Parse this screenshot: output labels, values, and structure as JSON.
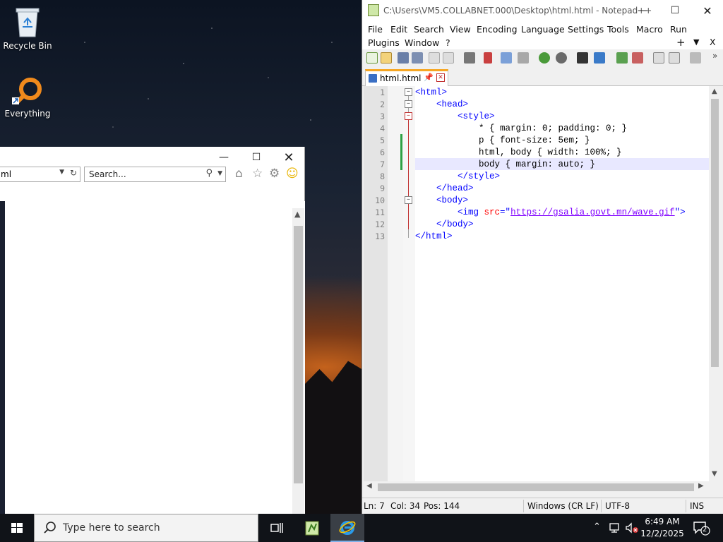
{
  "desktop": {
    "icons": [
      {
        "label": "Recycle Bin"
      },
      {
        "label": "Everything"
      }
    ]
  },
  "browser": {
    "address_value": "ml",
    "search_placeholder": "Search..."
  },
  "notepad": {
    "title": "C:\\Users\\VM5.COLLABNET.000\\Desktop\\html.html - Notepad++",
    "menu": [
      "File",
      "Edit",
      "Search",
      "View",
      "Encoding",
      "Language",
      "Settings",
      "Tools",
      "Macro",
      "Run",
      "Plugins",
      "Window",
      "?"
    ],
    "menu_right": {
      "plus": "+",
      "dropdown": "▼",
      "close": "X"
    },
    "tab_label": "html.html",
    "lines": [
      {
        "n": "1",
        "text": "<html>"
      },
      {
        "n": "2",
        "text": "    <head>"
      },
      {
        "n": "3",
        "text": "        <style>"
      },
      {
        "n": "4",
        "text": "            * { margin: 0; padding: 0; }"
      },
      {
        "n": "5",
        "text": "            p { font-size: 5em; }"
      },
      {
        "n": "6",
        "text": "            html, body { width: 100%; }"
      },
      {
        "n": "7",
        "text": "            body { margin: auto; }"
      },
      {
        "n": "8",
        "text": "        </style>"
      },
      {
        "n": "9",
        "text": "    </head>"
      },
      {
        "n": "10",
        "text": "    <body>"
      },
      {
        "n": "11",
        "text": "        <img src=\"https://gsalia.govt.mn/wave.gif\">"
      },
      {
        "n": "12",
        "text": "    </body>"
      },
      {
        "n": "13",
        "text": "</html>"
      }
    ],
    "line11": {
      "indent": "        ",
      "open": "<img ",
      "attr": "src",
      "eq": "=\"",
      "url": "https://gsalia.govt.mn/wave.gif",
      "close": "\">"
    },
    "status": {
      "ln": "Ln: 7",
      "col": "Col: 34",
      "pos": "Pos: 144",
      "eol": "Windows (CR LF)",
      "encoding": "UTF-8",
      "mode": "INS"
    }
  },
  "taskbar": {
    "search_placeholder": "Type here to search",
    "time": "6:49 AM",
    "date": "12/2/2025",
    "notification_count": "2"
  },
  "colors": {
    "tag": "#0000ff",
    "attr": "#ff0000",
    "url": "#8000ff",
    "tab_accent": "#f6a623",
    "changed_line_marker": "#2ea043"
  }
}
